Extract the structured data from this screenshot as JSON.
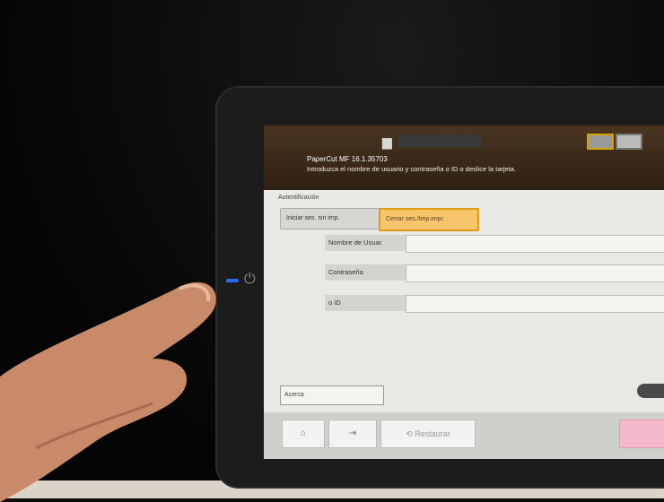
{
  "printer": {
    "app_name": "PaperCut MF 16.1.35703",
    "instruction": "Introduzca el nombre de usuario y contraseña o ID o deslice la tarjeta.",
    "status_text": "",
    "lang_buttons": [
      "",
      ""
    ]
  },
  "panel": {
    "title": "Autentificación",
    "tab_start": "Iniciar ses. sin imp.",
    "tab_release": "Cerrar ses./Imp.impr.",
    "fields": {
      "username_label": "Nombre de Usuar.",
      "password_label": "Contraseña",
      "id_label": "o ID"
    },
    "about_label": "Acerca"
  },
  "bottombar": {
    "home_icon": "⌂",
    "logout_icon": "⇥",
    "restore_label": "Restaurar",
    "restore_icon": "⟲"
  }
}
